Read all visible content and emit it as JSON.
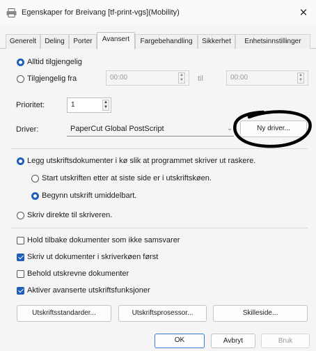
{
  "window": {
    "title": "Egenskaper for Breivang [tf-print-vgs](Mobility)",
    "close_symbol": "✕"
  },
  "tabs": [
    {
      "label": "Generelt"
    },
    {
      "label": "Deling"
    },
    {
      "label": "Porter"
    },
    {
      "label": "Avansert"
    },
    {
      "label": "Fargebehandling"
    },
    {
      "label": "Sikkerhet"
    },
    {
      "label": "Enhetsinnstillinger"
    }
  ],
  "active_tab": "Avansert",
  "availability": {
    "always_label": "Alltid tilgjengelig",
    "from_label": "Tilgjengelig fra",
    "from_time": "00:00",
    "to_label": "til",
    "to_time": "00:00",
    "selected": "always"
  },
  "priority": {
    "label": "Prioritet:",
    "value": "1"
  },
  "driver": {
    "label": "Driver:",
    "value": "PaperCut Global PostScript",
    "new_driver_button": "Ny driver..."
  },
  "spool": {
    "spool_label": "Legg utskriftsdokumenter i kø slik at programmet skriver ut raskere.",
    "after_last_page_label": "Start utskriften etter at siste side er i utskriftskøen.",
    "immediately_label": "Begynn utskrift umiddelbart.",
    "direct_label": "Skriv direkte til skriveren.",
    "selected": "spool",
    "spool_mode": "immediately"
  },
  "options": [
    {
      "label": "Hold tilbake dokumenter som ikke samsvarer",
      "checked": false
    },
    {
      "label": "Skriv ut dokumenter i skriverkøen først",
      "checked": true
    },
    {
      "label": "Behold utskrevne dokumenter",
      "checked": false
    },
    {
      "label": "Aktiver avanserte utskriftsfunksjoner",
      "checked": true
    }
  ],
  "buttons": {
    "defaults": "Utskriftsstandarder...",
    "processor": "Utskriftsprosessor...",
    "separator": "Skilleside..."
  },
  "footer": {
    "ok": "OK",
    "cancel": "Avbryt",
    "apply": "Bruk"
  },
  "colors": {
    "accent": "#1f5fb8",
    "annotation_ink": "#000000"
  }
}
